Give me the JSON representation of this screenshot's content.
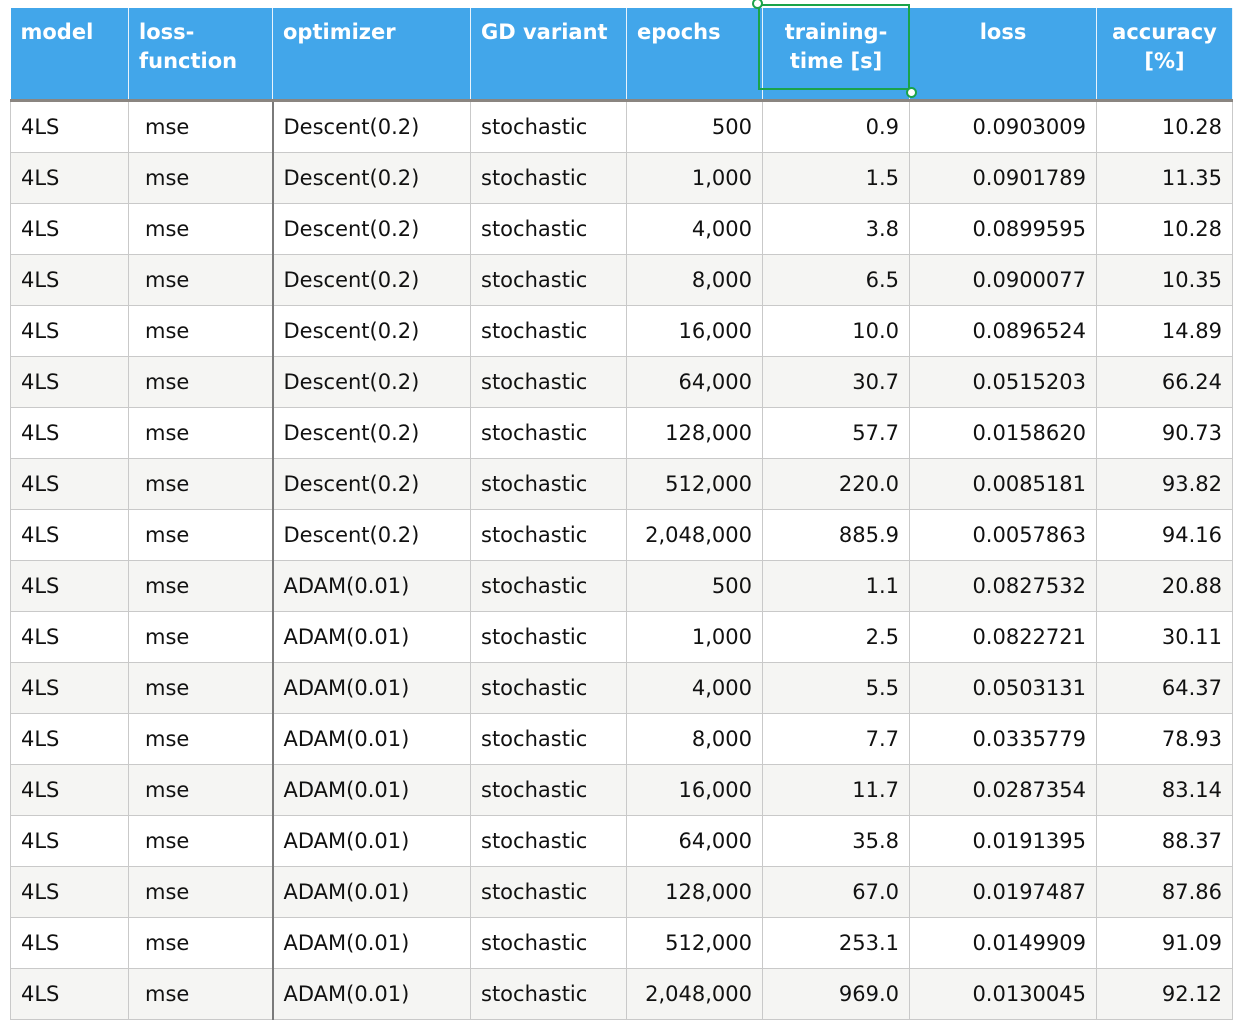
{
  "headers": [
    "model",
    "loss-\nfunction",
    "optimizer",
    "GD variant",
    "epochs",
    "training-\ntime [s]",
    "loss",
    "accuracy\n[%]"
  ],
  "rows": [
    [
      "4LS",
      "mse",
      "Descent(0.2)",
      "stochastic",
      "500",
      "0.9",
      "0.0903009",
      "10.28"
    ],
    [
      "4LS",
      "mse",
      "Descent(0.2)",
      "stochastic",
      "1,000",
      "1.5",
      "0.0901789",
      "11.35"
    ],
    [
      "4LS",
      "mse",
      "Descent(0.2)",
      "stochastic",
      "4,000",
      "3.8",
      "0.0899595",
      "10.28"
    ],
    [
      "4LS",
      "mse",
      "Descent(0.2)",
      "stochastic",
      "8,000",
      "6.5",
      "0.0900077",
      "10.35"
    ],
    [
      "4LS",
      "mse",
      "Descent(0.2)",
      "stochastic",
      "16,000",
      "10.0",
      "0.0896524",
      "14.89"
    ],
    [
      "4LS",
      "mse",
      "Descent(0.2)",
      "stochastic",
      "64,000",
      "30.7",
      "0.0515203",
      "66.24"
    ],
    [
      "4LS",
      "mse",
      "Descent(0.2)",
      "stochastic",
      "128,000",
      "57.7",
      "0.0158620",
      "90.73"
    ],
    [
      "4LS",
      "mse",
      "Descent(0.2)",
      "stochastic",
      "512,000",
      "220.0",
      "0.0085181",
      "93.82"
    ],
    [
      "4LS",
      "mse",
      "Descent(0.2)",
      "stochastic",
      "2,048,000",
      "885.9",
      "0.0057863",
      "94.16"
    ],
    [
      "4LS",
      "mse",
      "ADAM(0.01)",
      "stochastic",
      "500",
      "1.1",
      "0.0827532",
      "20.88"
    ],
    [
      "4LS",
      "mse",
      "ADAM(0.01)",
      "stochastic",
      "1,000",
      "2.5",
      "0.0822721",
      "30.11"
    ],
    [
      "4LS",
      "mse",
      "ADAM(0.01)",
      "stochastic",
      "4,000",
      "5.5",
      "0.0503131",
      "64.37"
    ],
    [
      "4LS",
      "mse",
      "ADAM(0.01)",
      "stochastic",
      "8,000",
      "7.7",
      "0.0335779",
      "78.93"
    ],
    [
      "4LS",
      "mse",
      "ADAM(0.01)",
      "stochastic",
      "16,000",
      "11.7",
      "0.0287354",
      "83.14"
    ],
    [
      "4LS",
      "mse",
      "ADAM(0.01)",
      "stochastic",
      "64,000",
      "35.8",
      "0.0191395",
      "88.37"
    ],
    [
      "4LS",
      "mse",
      "ADAM(0.01)",
      "stochastic",
      "128,000",
      "67.0",
      "0.0197487",
      "87.86"
    ],
    [
      "4LS",
      "mse",
      "ADAM(0.01)",
      "stochastic",
      "512,000",
      "253.1",
      "0.0149909",
      "91.09"
    ],
    [
      "4LS",
      "mse",
      "ADAM(0.01)",
      "stochastic",
      "2,048,000",
      "969.0",
      "0.0130045",
      "92.12"
    ]
  ],
  "colors": {
    "header": "#42a6ea",
    "selection": "#1aa34a"
  }
}
